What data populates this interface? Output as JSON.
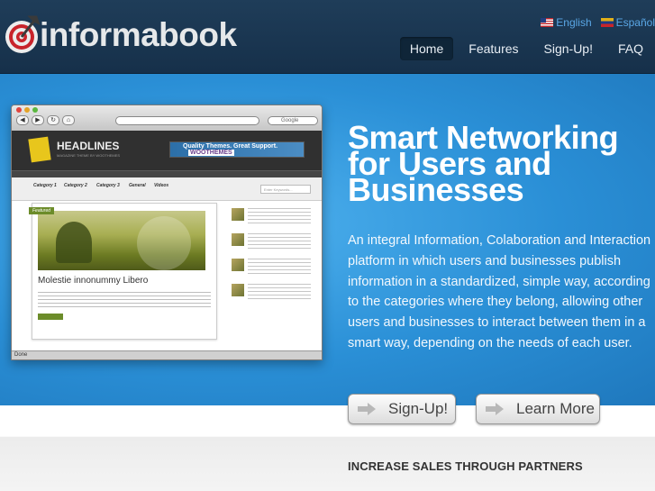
{
  "header": {
    "brand": "informabook",
    "languages": [
      {
        "label": "English",
        "flag": "us-flag"
      },
      {
        "label": "Español",
        "flag": "spain-flag"
      }
    ],
    "nav": [
      {
        "label": "Home",
        "active": true
      },
      {
        "label": "Features",
        "active": false
      },
      {
        "label": "Sign-Up!",
        "active": false
      },
      {
        "label": "FAQ",
        "active": false
      }
    ]
  },
  "hero": {
    "title": "Smart Networking for Users and Businesses",
    "description": "An integral Information, Colaboration and Interaction platform in which users and businesses publish information in a standardized, simple way, according to the categories where they belong, allowing other users and businesses to interact between them in a smart way, depending on the needs of each user.",
    "signup_button": "Sign-Up!",
    "learn_button": "Learn More"
  },
  "mockup": {
    "search_placeholder": "Google",
    "site_name": "HEADLINES",
    "site_tagline": "MAGAZINE THEME BY WOOTHEMES",
    "ad_text": "Quality Themes. Great Support.",
    "ad_brand": "WOOTHEMES",
    "categories": [
      "Category 1",
      "Category 2",
      "Category 3",
      "General",
      "Videos"
    ],
    "search_field": "Enter Keywords...",
    "featured_badge": "Featured",
    "featured_title": "Molestie innonummy Libero",
    "status": "Done"
  },
  "lower": {
    "heading": "INCREASE SALES THROUGH PARTNERS"
  },
  "colors": {
    "header_bg": "#1f3d59",
    "hero_bg": "#2a8fd6",
    "link": "#5aa7e6",
    "nav_active_bg": "#0f2538"
  }
}
